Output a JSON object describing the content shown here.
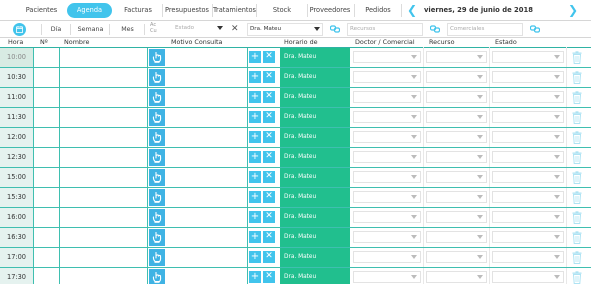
{
  "tabs": [
    {
      "label": "Pacientes",
      "active": false
    },
    {
      "label": "Agenda",
      "active": true
    },
    {
      "label": "Facturas",
      "active": false
    },
    {
      "label": "Presupuestos",
      "active": false
    },
    {
      "label": "Tratamientos",
      "active": false
    },
    {
      "label": "Stock",
      "active": false
    },
    {
      "label": "Proveedores",
      "active": false
    },
    {
      "label": "Pedidos",
      "active": false
    }
  ],
  "date": {
    "label": "viernes, 29 de junio de 2018",
    "prev_icon": "chevron-left-icon",
    "next_icon": "chevron-right-icon"
  },
  "toolbar": {
    "calendar_icon": "calendar-icon",
    "views": [
      "Día",
      "Semana",
      "Mes"
    ],
    "small_label": "Ac Cu",
    "estado_placeholder": "Estado",
    "doctor_value": "Dra. Mateu",
    "recursos_placeholder": "Recursos",
    "comerciales_placeholder": "Comerciales",
    "clear_icon": "close-icon",
    "link_icon": "link-icon"
  },
  "columns": [
    "Hora",
    "Nº",
    "Nombre",
    "Motivo Consulta",
    "Horario de",
    "Doctor / Comercial",
    "Recurso",
    "Estado"
  ],
  "rows": [
    {
      "time": "10:00",
      "horario": "Dra. Mateu"
    },
    {
      "time": "10:30",
      "horario": "Dra. Mateu"
    },
    {
      "time": "11:00",
      "horario": "Dra. Mateu"
    },
    {
      "time": "11:30",
      "horario": "Dra. Mateu"
    },
    {
      "time": "12:00",
      "horario": "Dra. Mateu"
    },
    {
      "time": "12:30",
      "horario": "Dra. Mateu"
    },
    {
      "time": "15:00",
      "horario": "Dra. Mateu"
    },
    {
      "time": "15:30",
      "horario": "Dra. Mateu"
    },
    {
      "time": "16:00",
      "horario": "Dra. Mateu"
    },
    {
      "time": "16:30",
      "horario": "Dra. Mateu"
    },
    {
      "time": "17:00",
      "horario": "Dra. Mateu"
    },
    {
      "time": "17:30",
      "horario": "Dra. Mateu"
    }
  ],
  "row_icons": {
    "motivo": "hand-pointer-icon",
    "add": "plus-icon",
    "remove": "close-icon",
    "delete": "trash-icon"
  },
  "colors": {
    "accent": "#41c4ec",
    "horario_green": "#21bf8e",
    "grid_line": "#3fbfb0"
  }
}
